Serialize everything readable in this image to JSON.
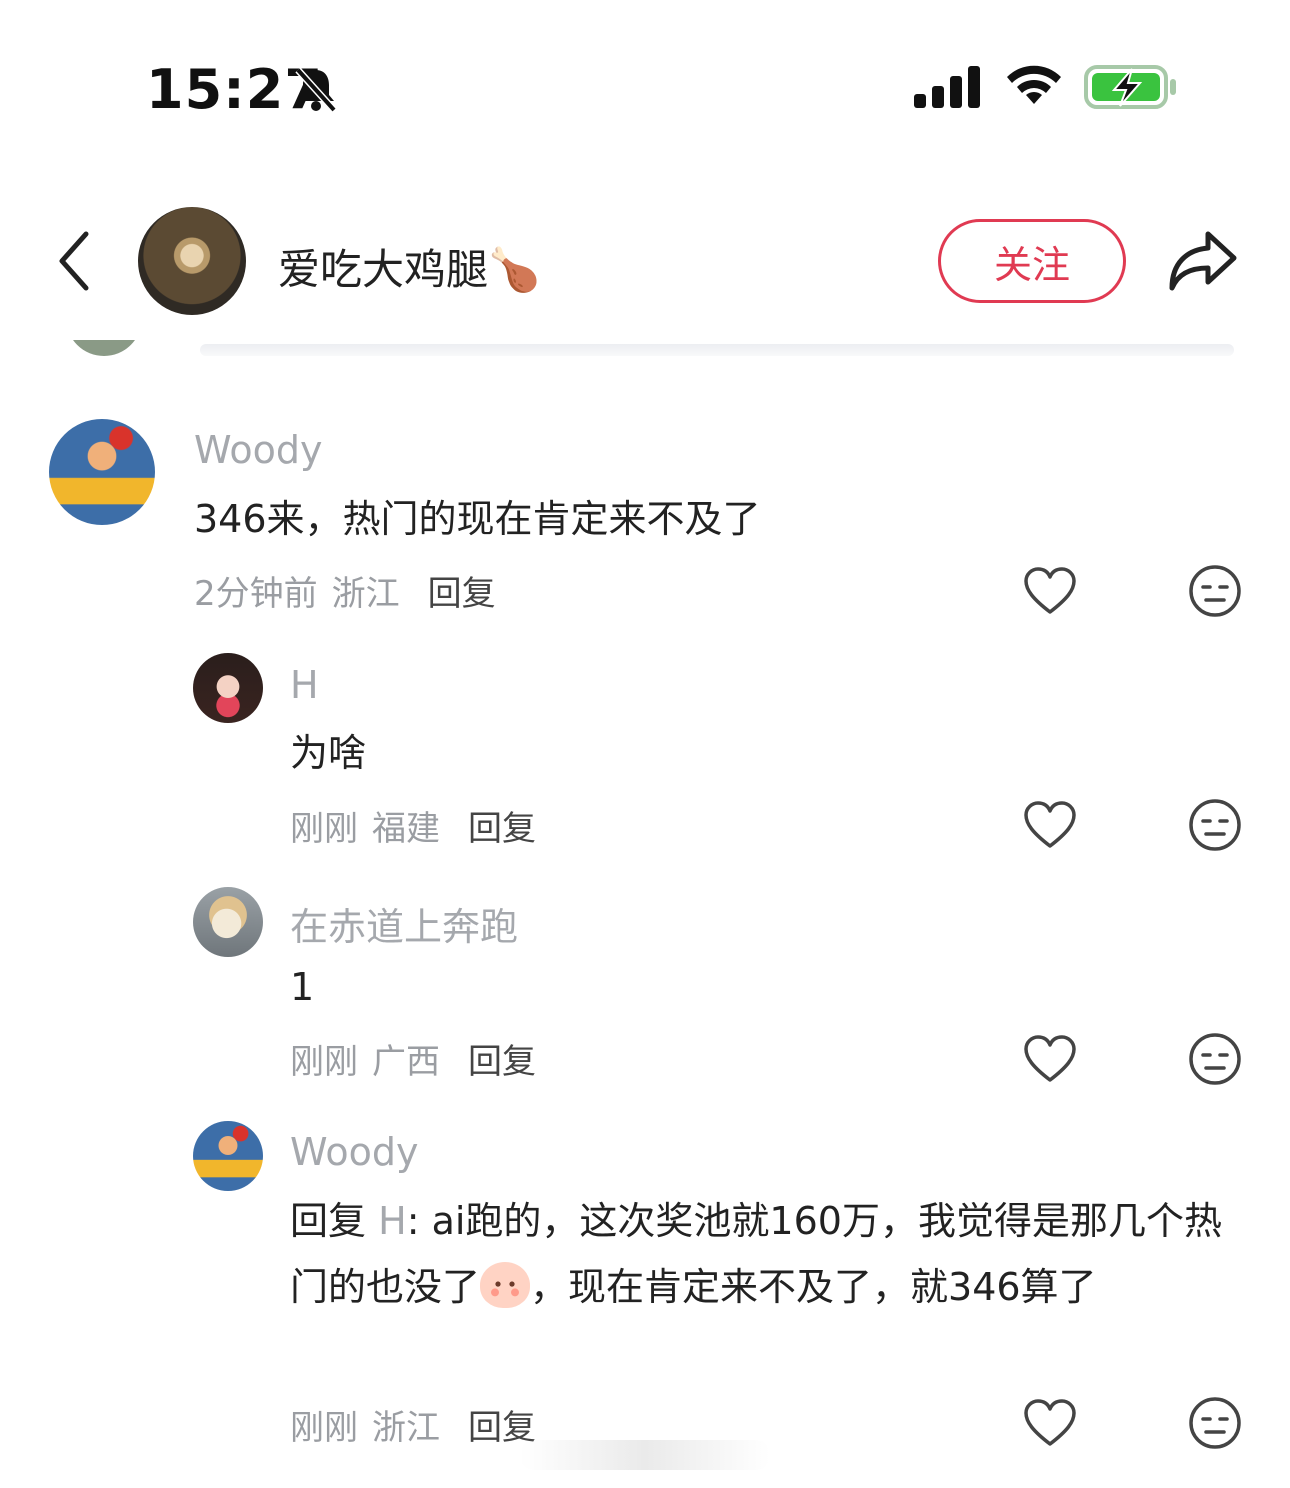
{
  "status_bar": {
    "time": "15:27",
    "icons": [
      "bell-slash-icon",
      "cellular-signal-icon",
      "wifi-icon",
      "battery-charging-icon"
    ],
    "battery_color": "#3ac33f"
  },
  "header": {
    "title": "爱吃大鸡腿🍗",
    "follow_label": "关注",
    "accent_color": "#e03a52"
  },
  "comments": [
    {
      "username": "Woody",
      "text": "346来，热门的现在肯定来不及了",
      "time": "2分钟前",
      "region": "浙江",
      "reply_label": "回复",
      "replies": [
        {
          "username": "H",
          "text": "为啥",
          "time": "刚刚",
          "region": "福建",
          "reply_label": "回复"
        },
        {
          "username": "在赤道上奔跑",
          "text": "1",
          "time": "刚刚",
          "region": "广西",
          "reply_label": "回复"
        },
        {
          "username": "Woody",
          "reply_prefix": "回复",
          "reply_to": "H",
          "text_part1": ": ai跑的，这次奖池就160万，我觉得是那几个热门的也没了",
          "text_part2": "，现在肯定来不及了，就346算了",
          "time": "刚刚",
          "region": "浙江",
          "reply_label": "回复"
        }
      ]
    }
  ]
}
